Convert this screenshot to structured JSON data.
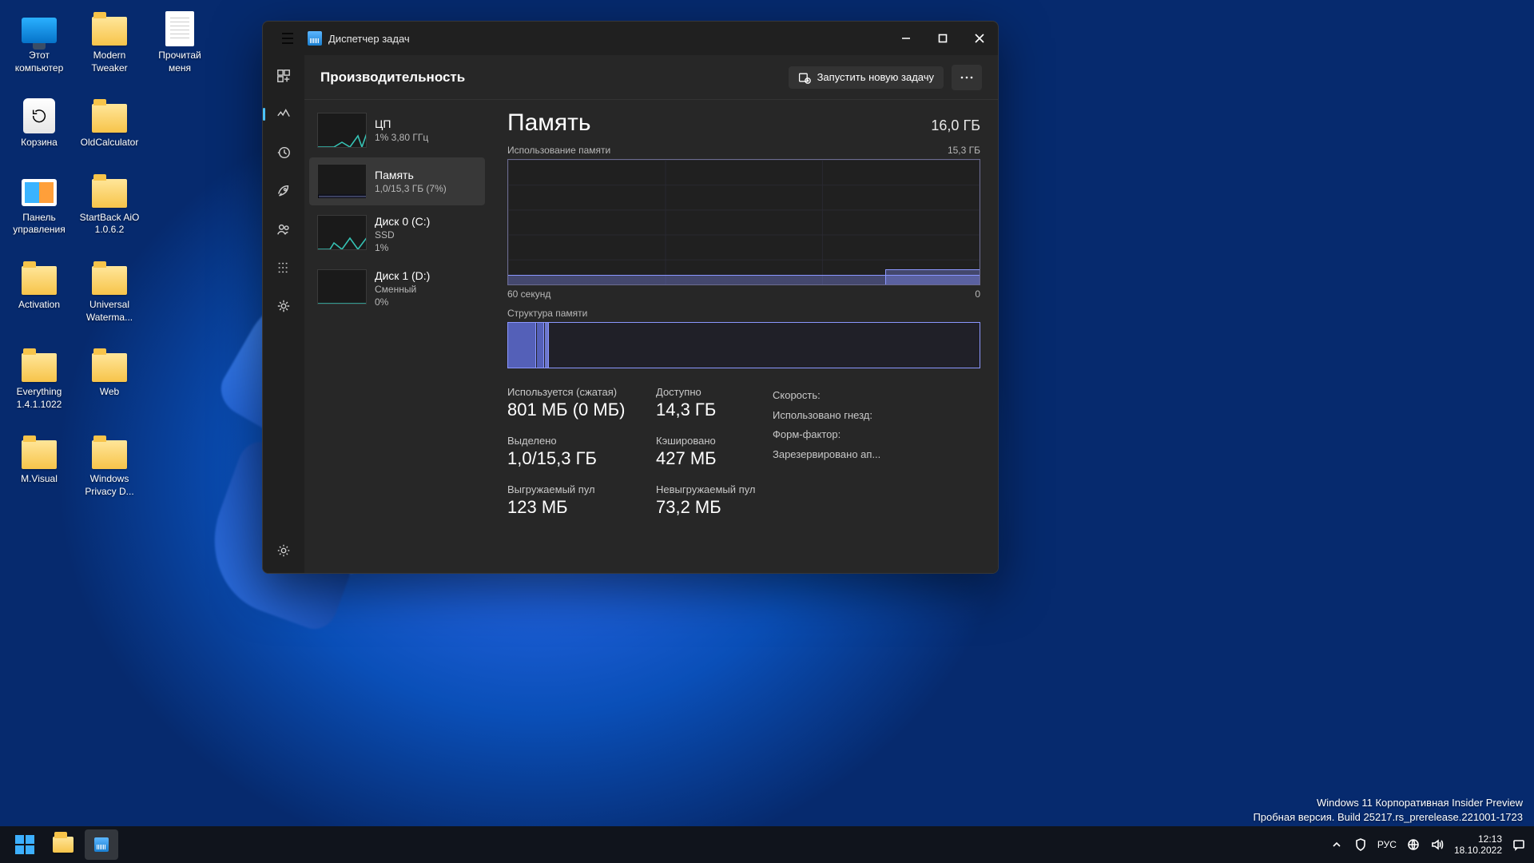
{
  "desktop": {
    "icons": [
      {
        "label": "Этот компьютер",
        "type": "monitor"
      },
      {
        "label": "Modern Tweaker",
        "type": "folder"
      },
      {
        "label": "Прочитай меня",
        "type": "doc"
      },
      {
        "label": "Корзина",
        "type": "bin"
      },
      {
        "label": "OldCalculator",
        "type": "folder"
      },
      {
        "label": "",
        "type": "blank"
      },
      {
        "label": "Панель управления",
        "type": "panel"
      },
      {
        "label": "StartBack AiO 1.0.6.2",
        "type": "folder"
      },
      {
        "label": "",
        "type": "blank"
      },
      {
        "label": "Activation",
        "type": "folder"
      },
      {
        "label": "Universal Waterma...",
        "type": "folder"
      },
      {
        "label": "",
        "type": "blank"
      },
      {
        "label": "Everything 1.4.1.1022",
        "type": "folder"
      },
      {
        "label": "Web",
        "type": "folder"
      },
      {
        "label": "",
        "type": "blank"
      },
      {
        "label": "M.Visual",
        "type": "folder"
      },
      {
        "label": "Windows Privacy D...",
        "type": "folder"
      }
    ]
  },
  "watermark": {
    "line1": "Windows 11 Корпоративная Insider Preview",
    "line2": "Пробная версия. Build 25217.rs_prerelease.221001-1723"
  },
  "taskbar": {
    "lang": "РУС",
    "time": "12:13",
    "date": "18.10.2022"
  },
  "tm": {
    "title": "Диспетчер задач",
    "pageTitle": "Производительность",
    "runTask": "Запустить новую задачу",
    "resources": [
      {
        "name": "ЦП",
        "sub": "1%  3,80 ГГц"
      },
      {
        "name": "Память",
        "sub": "1,0/15,3 ГБ (7%)"
      },
      {
        "name": "Диск 0 (C:)",
        "sub": "SSD",
        "sub2": "1%"
      },
      {
        "name": "Диск 1 (D:)",
        "sub": "Сменный",
        "sub2": "0%"
      }
    ],
    "detail": {
      "title": "Память",
      "total": "16,0 ГБ",
      "usageLabel": "Использование памяти",
      "usageMax": "15,3 ГБ",
      "axisLeft": "60 секунд",
      "axisRight": "0",
      "compLabel": "Структура памяти",
      "stats": {
        "inUseLabel": "Используется (сжатая)",
        "inUse": "801 МБ (0 МБ)",
        "availLabel": "Доступно",
        "avail": "14,3 ГБ",
        "commitLabel": "Выделено",
        "commit": "1,0/15,3 ГБ",
        "cachedLabel": "Кэшировано",
        "cached": "427 МБ",
        "pagedLabel": "Выгружаемый пул",
        "paged": "123 МБ",
        "nonpagedLabel": "Невыгружаемый пул",
        "nonpaged": "73,2 МБ"
      },
      "side": {
        "speed": "Скорость:",
        "slots": "Использовано гнезд:",
        "form": "Форм-фактор:",
        "reserved": "Зарезервировано ап..."
      }
    }
  },
  "chart_data": {
    "type": "area",
    "title": "Использование памяти",
    "xlabel": "60 секунд",
    "ylabel": "ГБ",
    "ylim": [
      0,
      15.3
    ],
    "x_seconds": [
      60,
      55,
      50,
      45,
      40,
      35,
      30,
      25,
      20,
      15,
      10,
      5,
      0
    ],
    "values_gb": [
      1.0,
      1.0,
      1.0,
      1.0,
      1.0,
      1.0,
      1.0,
      1.0,
      1.0,
      1.1,
      1.6,
      1.6,
      1.6
    ],
    "composition": {
      "in_use_mb": 801,
      "compressed_mb": 0,
      "cached_mb": 427,
      "available_gb": 14.3,
      "committed_gb": 1.0,
      "commit_limit_gb": 15.3,
      "paged_pool_mb": 123,
      "nonpaged_pool_mb": 73.2,
      "total_gb": 16.0
    }
  }
}
